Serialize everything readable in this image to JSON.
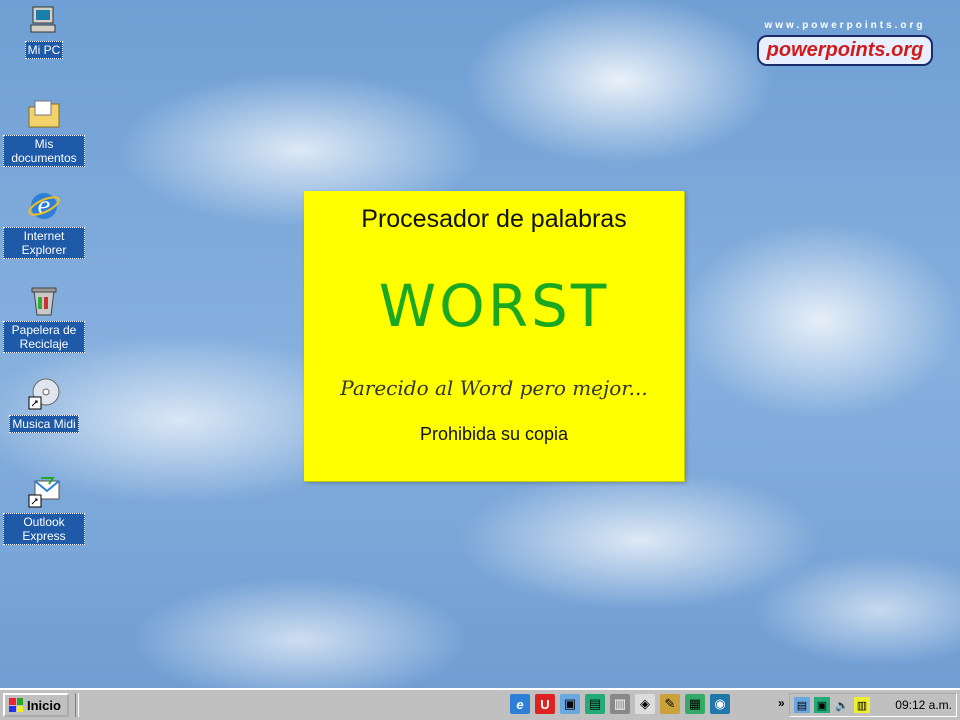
{
  "desktop": {
    "icons": [
      {
        "label": "Mi PC",
        "icon": "computer-icon"
      },
      {
        "label": "Mis documentos",
        "icon": "folder-icon"
      },
      {
        "label": "Internet Explorer",
        "icon": "ie-icon"
      },
      {
        "label": "Papelera de Reciclaje",
        "icon": "recycle-bin-icon"
      },
      {
        "label": "Musica Midi",
        "icon": "cd-icon"
      },
      {
        "label": "Outlook Express",
        "icon": "outlook-icon"
      }
    ]
  },
  "logo": {
    "url": "www.powerpoints.org",
    "brand": "powerpoints.org"
  },
  "card": {
    "heading": "Procesador de palabras",
    "title": "WORST",
    "tagline": "Parecido al Word pero mejor...",
    "footer": "Prohibida su copia",
    "background_color": "#ffff00",
    "title_color": "#19a81f"
  },
  "taskbar": {
    "start_label": "Inicio",
    "chevron": "»",
    "clock": "09:12 a.m."
  }
}
